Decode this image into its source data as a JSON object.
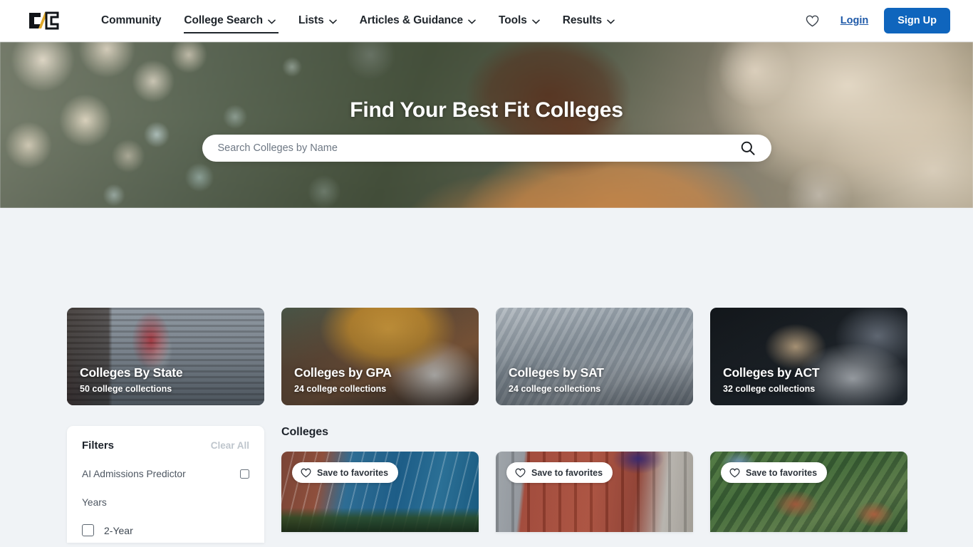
{
  "navbar": {
    "logo_alt": "CollegeVine C/C logo",
    "links": [
      {
        "label": "Community",
        "has_dropdown": false,
        "active": false
      },
      {
        "label": "College Search",
        "has_dropdown": true,
        "active": true
      },
      {
        "label": "Lists",
        "has_dropdown": true,
        "active": false
      },
      {
        "label": "Articles & Guidance",
        "has_dropdown": true,
        "active": false
      },
      {
        "label": "Tools",
        "has_dropdown": true,
        "active": false
      },
      {
        "label": "Results",
        "has_dropdown": true,
        "active": false
      }
    ],
    "favorites_icon": "heart-icon",
    "login_label": "Login",
    "signup_label": "Sign Up",
    "accent_blue": "#0f65bd",
    "link_blue": "#1e59a8"
  },
  "hero": {
    "title": "Find Your Best Fit Colleges",
    "search_placeholder": "Search Colleges by Name",
    "search_value": "",
    "search_icon": "search-icon"
  },
  "collections": [
    {
      "title": "Colleges By State",
      "subtitle": "50 college collections",
      "count": 50
    },
    {
      "title": "Colleges by GPA",
      "subtitle": "24 college collections",
      "count": 24
    },
    {
      "title": "Colleges by SAT",
      "subtitle": "24 college collections",
      "count": 24
    },
    {
      "title": "Colleges by ACT",
      "subtitle": "32 college collections",
      "count": 32
    }
  ],
  "filters": {
    "title": "Filters",
    "clear_all": "Clear All",
    "ai_predictor_label": "AI Admissions Predictor",
    "ai_predictor_checked": false,
    "years_group_label": "Years",
    "years_options": [
      {
        "label": "2-Year",
        "checked": false
      }
    ]
  },
  "results": {
    "heading": "Colleges",
    "cards": [
      {
        "favorite_label": "Save to favorites",
        "favorite_icon": "heart-icon"
      },
      {
        "favorite_label": "Save to favorites",
        "favorite_icon": "heart-icon"
      },
      {
        "favorite_label": "Save to favorites",
        "favorite_icon": "heart-icon"
      }
    ]
  },
  "colors": {
    "page_background": "#f0f3f6",
    "navbar_background": "#ffffff",
    "text_dark": "#20262c",
    "muted_text": "#bfc6cd"
  }
}
